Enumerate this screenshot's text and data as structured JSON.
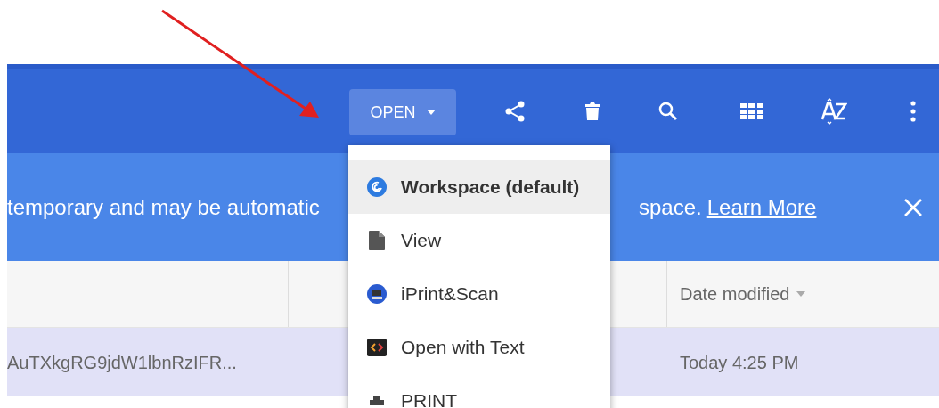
{
  "toolbar": {
    "open_button": {
      "label": "OPEN"
    }
  },
  "menu": {
    "items": [
      {
        "label": "Workspace (default)",
        "selected": true
      },
      {
        "label": "View",
        "selected": false
      },
      {
        "label": "iPrint&Scan",
        "selected": false
      },
      {
        "label": "Open with Text",
        "selected": false
      },
      {
        "label": "PRINT",
        "selected": false
      }
    ]
  },
  "banner": {
    "text_left": "temporary and may be automatic",
    "text_right": "space.",
    "link": "Learn More"
  },
  "table": {
    "columns": [
      {},
      {},
      {
        "label": "Date modified"
      }
    ],
    "rows": [
      {
        "name": "AuTXkgRG9jdW1lbnRzIFR...",
        "date": "Today 4:25 PM",
        "selected": true
      }
    ]
  }
}
